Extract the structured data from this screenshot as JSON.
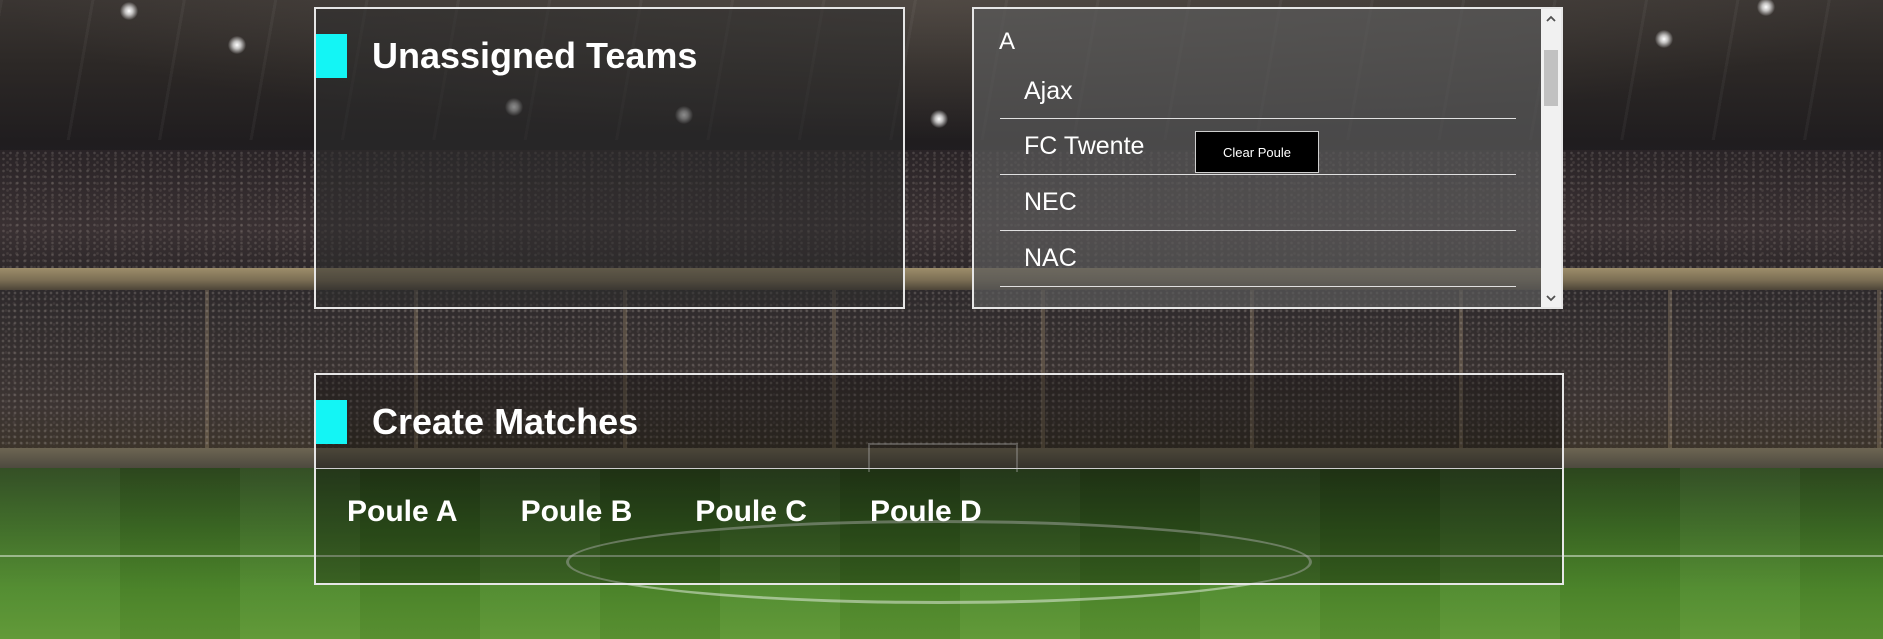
{
  "colors": {
    "accent": "#13f5f5",
    "panel_border": "#e6e6e6",
    "button_background": "#000000",
    "text": "#ffffff"
  },
  "unassigned": {
    "title": "Unassigned Teams"
  },
  "poule_list": {
    "group_label": "A",
    "teams": [
      "Ajax",
      "FC Twente",
      "NEC",
      "NAC"
    ],
    "clear_button_label": "Clear Poule"
  },
  "create_matches": {
    "title": "Create Matches",
    "tabs": [
      "Poule A",
      "Poule B",
      "Poule C",
      "Poule D"
    ]
  },
  "scrollbar": {
    "up_icon": "chevron-up-icon",
    "down_icon": "chevron-down-icon"
  }
}
